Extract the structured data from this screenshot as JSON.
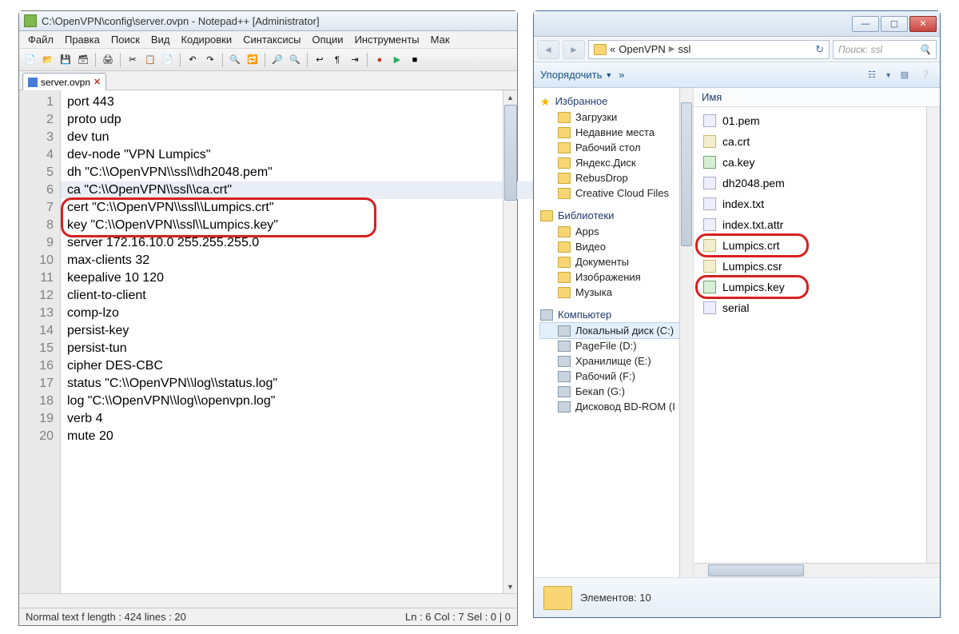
{
  "notepad": {
    "title": "C:\\OpenVPN\\config\\server.ovpn - Notepad++ [Administrator]",
    "menus": [
      "Файл",
      "Правка",
      "Поиск",
      "Вид",
      "Кодировки",
      "Синтаксисы",
      "Опции",
      "Инструменты",
      "Мак"
    ],
    "tab_name": "server.ovpn",
    "code_lines": [
      "port 443",
      "proto udp",
      "dev tun",
      "dev-node \"VPN Lumpics\"",
      "dh \"C:\\\\OpenVPN\\\\ssl\\\\dh2048.pem\"",
      "ca \"C:\\\\OpenVPN\\\\ssl\\\\ca.crt\"",
      "cert \"C:\\\\OpenVPN\\\\ssl\\\\Lumpics.crt\"",
      "key \"C:\\\\OpenVPN\\\\ssl\\\\Lumpics.key\"",
      "server 172.16.10.0 255.255.255.0",
      "max-clients 32",
      "keepalive 10 120",
      "client-to-client",
      "comp-lzo",
      "persist-key",
      "persist-tun",
      "cipher DES-CBC",
      "status \"C:\\\\OpenVPN\\\\log\\\\status.log\"",
      "log \"C:\\\\OpenVPN\\\\log\\\\openvpn.log\"",
      "verb 4",
      "mute 20"
    ],
    "cursor_line_index": 5,
    "status_left": "Normal text f  length : 424    lines : 20",
    "status_right": "Ln : 6    Col : 7    Sel : 0 | 0"
  },
  "explorer": {
    "breadcrumb": {
      "prefix": "«",
      "p1": "OpenVPN",
      "p2": "ssl"
    },
    "search_placeholder": "Поиск: ssl",
    "cmdbar": {
      "organize": "Упорядочить",
      "more": "»"
    },
    "column_header": "Имя",
    "tree": {
      "favorites_title": "Избранное",
      "favorites": [
        "Загрузки",
        "Недавние места",
        "Рабочий стол",
        "Яндекс.Диск",
        "RebusDrop",
        "Creative Cloud Files"
      ],
      "libraries_title": "Библиотеки",
      "libraries": [
        "Apps",
        "Видео",
        "Документы",
        "Изображения",
        "Музыка"
      ],
      "computer_title": "Компьютер",
      "drives": [
        "Локальный диск (C:)",
        "PageFile (D:)",
        "Хранилище (E:)",
        "Рабочий (F:)",
        "Бекап (G:)",
        "Дисковод BD-ROM (I"
      ]
    },
    "files": [
      "01.pem",
      "ca.crt",
      "ca.key",
      "dh2048.pem",
      "index.txt",
      "index.txt.attr",
      "Lumpics.crt",
      "Lumpics.csr",
      "Lumpics.key",
      "serial"
    ],
    "highlighted_files": [
      "Lumpics.crt",
      "Lumpics.key"
    ],
    "status": "Элементов: 10"
  }
}
